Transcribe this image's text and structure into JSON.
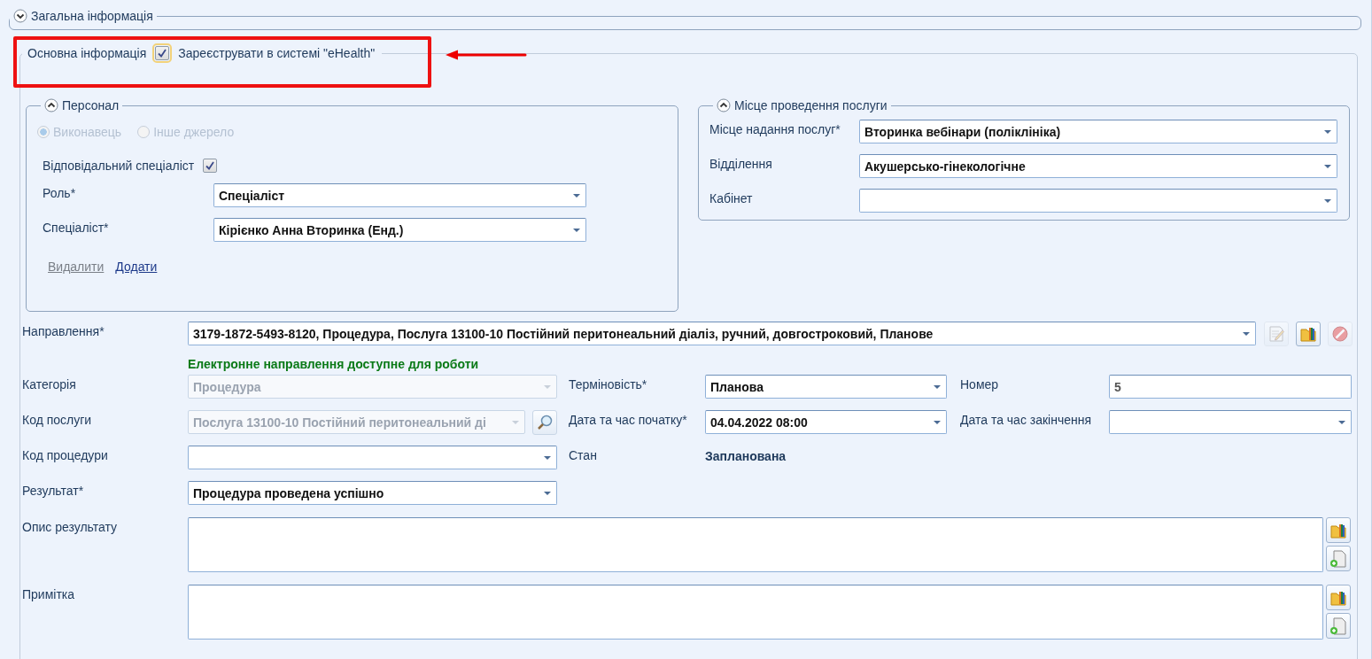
{
  "section": {
    "title": "Загальна інформація",
    "expanded": false
  },
  "main_group": {
    "title": "Основна інформація",
    "register": {
      "label": "Зареєструвати в системі \"eHealth\"",
      "checked": true
    }
  },
  "personnel": {
    "title": "Персонал",
    "expanded": true,
    "source_options": [
      {
        "label": "Виконавець",
        "selected": true,
        "disabled": true
      },
      {
        "label": "Інше джерело",
        "selected": false,
        "disabled": true
      }
    ],
    "responsible": {
      "label": "Відповідальний спеціаліст",
      "checked": true
    },
    "fields": [
      {
        "label": "Роль*",
        "value": "Спеціаліст"
      },
      {
        "label": "Спеціаліст*",
        "value": "Кірієнко Анна Вторинка (Енд.)"
      }
    ],
    "links": [
      {
        "label": "Видалити",
        "disabled": true
      },
      {
        "label": "Додати",
        "disabled": false
      }
    ]
  },
  "location": {
    "title": "Місце проведення послуги",
    "expanded": true,
    "fields": [
      {
        "label": "Місце надання послуг*",
        "value": "Вторинка вебінари (поліклініка)"
      },
      {
        "label": "Відділення",
        "value": "Акушерсько-гінекологічне"
      },
      {
        "label": "Кабінет"
      }
    ]
  },
  "referral": {
    "label": "Направлення*",
    "value": "3179-1872-5493-8120, Процедура, Послуга 13100-10 Постійний перитонеальний діаліз, ручний, довгостроковий, Планове",
    "status": "Електронне направлення доступне для роботи",
    "buttons": [
      {
        "kind": "edit",
        "disabled": true
      },
      {
        "kind": "folder",
        "disabled": false
      },
      {
        "kind": "cancel",
        "disabled": true
      }
    ]
  },
  "rows": [
    [
      {
        "label": "Категорія",
        "value": "Процедура",
        "kind": "combo",
        "disabled": true
      },
      {
        "label": "Терміновість*",
        "value": "Планова",
        "kind": "combo",
        "disabled": false
      },
      {
        "label": "Номер",
        "value": "5",
        "kind": "text",
        "disabled": false
      }
    ],
    [
      {
        "label": "Код послуги",
        "value": "Послуга 13100-10 Постійний перитонеальний ді",
        "kind": "lookup",
        "disabled": true
      },
      {
        "label": "Дата та час початку*",
        "value": "04.04.2022 08:00",
        "kind": "combo",
        "disabled": false
      },
      {
        "label": "Дата та час закінчення",
        "kind": "combo",
        "disabled": false
      }
    ],
    [
      {
        "label": "Код процедури",
        "kind": "combo",
        "disabled": false
      },
      {
        "label": "Стан",
        "value": "Запланована",
        "kind": "status"
      }
    ],
    [
      {
        "label": "Результат*",
        "value": "Процедура проведена успішно",
        "kind": "combo",
        "disabled": false
      }
    ]
  ],
  "notes": [
    {
      "label": "Опис результату"
    },
    {
      "label": "Примітка"
    }
  ]
}
